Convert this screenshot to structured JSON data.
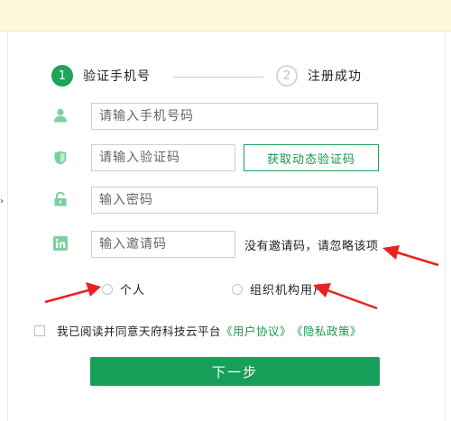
{
  "steps": [
    {
      "num": "1",
      "label": "验证手机号"
    },
    {
      "num": "2",
      "label": "注册成功"
    }
  ],
  "form": {
    "phone_placeholder": "请输入手机号码",
    "code_placeholder": "请输入验证码",
    "get_code_label": "获取动态验证码",
    "password_placeholder": "输入密码",
    "invite_placeholder": "输入邀请码",
    "invite_hint": "没有邀请码，请忽略该项"
  },
  "user_type": {
    "personal": "个人",
    "org": "组织机构用户"
  },
  "agreement": {
    "prefix": "我已阅读并同意天府科技云平台",
    "user_agreement": "《用户协议》",
    "privacy_policy": "《隐私政策》"
  },
  "next_label": "下一步",
  "icons": {
    "phone": "user-icon",
    "code": "shield-icon",
    "password": "unlock-icon",
    "invite": "linkedin-icon"
  },
  "colors": {
    "accent": "#1da35a",
    "icon": "#7ccf9f",
    "annotation": "#e8231f",
    "notice_bg": "#fdf8dc"
  }
}
